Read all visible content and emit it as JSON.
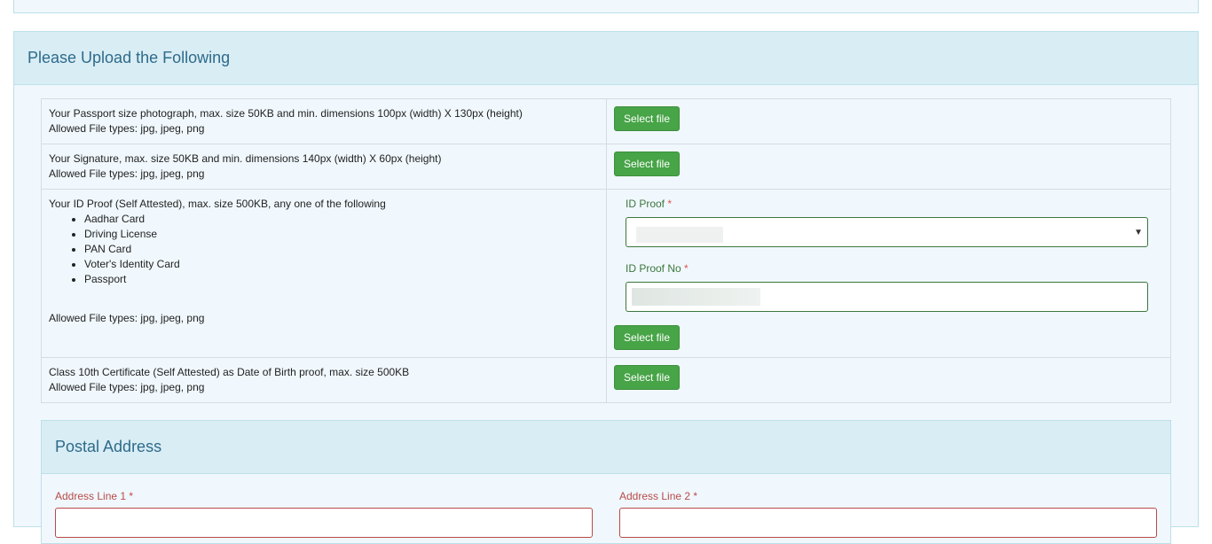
{
  "upload_panel": {
    "title": "Please Upload the Following",
    "rows": [
      {
        "line1": "Your Passport size photograph, max. size 50KB and min. dimensions 100px (width) X 130px (height)",
        "line2": "Allowed File types: jpg, jpeg, png",
        "button": "Select file"
      },
      {
        "line1": "Your Signature, max. size 50KB and min. dimensions 140px (width) X 60px (height)",
        "line2": "Allowed File types: jpg, jpeg, png",
        "button": "Select file"
      },
      {
        "line1": "Your ID Proof (Self Attested), max. size 500KB, any one of the following",
        "items": [
          "Aadhar Card",
          "Driving License",
          "PAN Card",
          "Voter's Identity Card",
          "Passport"
        ],
        "line2": "Allowed File types: jpg, jpeg, png",
        "id_proof_label": "ID Proof",
        "id_proof_no_label": "ID Proof No",
        "required_mark": "*",
        "button": "Select file"
      },
      {
        "line1": "Class 10th Certificate (Self Attested) as Date of Birth proof, max. size 500KB",
        "line2": "Allowed File types: jpg, jpeg, png",
        "button": "Select file"
      }
    ]
  },
  "postal_panel": {
    "title": "Postal Address",
    "address_line1_label": "Address Line 1",
    "address_line2_label": "Address Line 2",
    "required_mark": "*"
  },
  "icons": {
    "select_arrow": "chevron-down-icon"
  },
  "colors": {
    "button": "#47a447",
    "panel_heading": "#d9edf5",
    "label_valid": "#3c763d",
    "label_error": "#b94a48"
  }
}
